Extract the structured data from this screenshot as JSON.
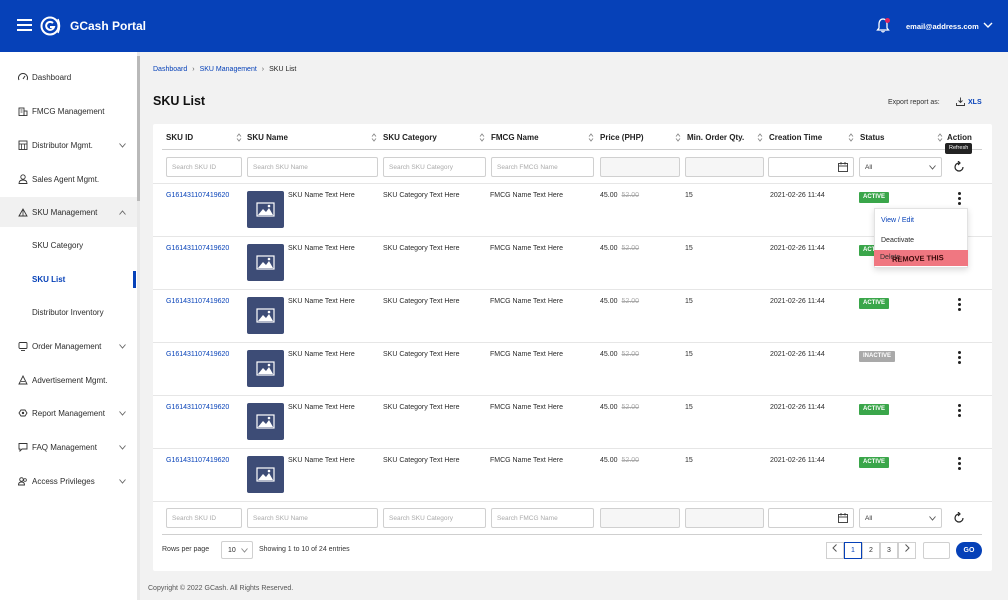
{
  "header": {
    "brand": "GCash Portal",
    "email": "email@address.com",
    "icons": [
      "menu-icon",
      "gcash-logo",
      "bell-icon",
      "chevron-down-icon"
    ]
  },
  "sidebar": {
    "items": [
      {
        "label": "Dashboard",
        "icon": "dashboard-icon"
      },
      {
        "label": "FMCG Management",
        "icon": "building-icon"
      },
      {
        "label": "Distributor Mgmt.",
        "icon": "warehouse-icon"
      },
      {
        "label": "Sales Agent Mgmt.",
        "icon": "user-icon"
      },
      {
        "label": "SKU Management",
        "icon": "box-icon"
      },
      {
        "label": "Order Management",
        "icon": "cart-icon"
      },
      {
        "label": "Advertisement Mgmt.",
        "icon": "megaphone-icon"
      },
      {
        "label": "Report Management",
        "icon": "report-icon"
      },
      {
        "label": "FAQ Management",
        "icon": "faq-icon"
      },
      {
        "label": "Access Privileges",
        "icon": "users-icon"
      }
    ],
    "sub_items": [
      {
        "label": "SKU Category"
      },
      {
        "label": "SKU List"
      },
      {
        "label": "Distributor Inventory"
      }
    ]
  },
  "breadcrumb": {
    "items": [
      "Dashboard",
      "SKU Management",
      "SKU List"
    ]
  },
  "page_title": "SKU List",
  "export": {
    "label": "Export report as:",
    "format": "XLS"
  },
  "table": {
    "columns": [
      "SKU ID",
      "SKU Name",
      "SKU Category",
      "FMCG Name",
      "Price (PHP)",
      "Min. Order Qty.",
      "Creation Time",
      "Status",
      "Action"
    ],
    "filters": {
      "sku_id": "Search SKU ID",
      "sku_name": "Search SKU Name",
      "sku_category": "Search SKU Category",
      "fmcg_name": "Search FMCG Name",
      "status": "All"
    },
    "tooltip": "Refresh",
    "rows": [
      {
        "id": "G161431107419620",
        "name": "SKU Name Text Here",
        "category": "SKU Category Text Here",
        "fmcg": "FMCG Name Text Here",
        "price": "45.00",
        "old_price": "52.00",
        "min_qty": "15",
        "created": "2021-02-26 11:44",
        "status": "ACTIVE"
      },
      {
        "id": "G161431107419620",
        "name": "SKU Name Text Here",
        "category": "SKU Category Text Here",
        "fmcg": "FMCG Name Text Here",
        "price": "45.00",
        "old_price": "52.00",
        "min_qty": "15",
        "created": "2021-02-26 11:44",
        "status": "ACTIVE"
      },
      {
        "id": "G161431107419620",
        "name": "SKU Name Text Here",
        "category": "SKU Category Text Here",
        "fmcg": "FMCG Name Text Here",
        "price": "45.00",
        "old_price": "52.00",
        "min_qty": "15",
        "created": "2021-02-26 11:44",
        "status": "ACTIVE"
      },
      {
        "id": "G161431107419620",
        "name": "SKU Name Text Here",
        "category": "SKU Category Text Here",
        "fmcg": "FMCG Name Text Here",
        "price": "45.00",
        "old_price": "52.00",
        "min_qty": "15",
        "created": "2021-02-26 11:44",
        "status": "INACTIVE"
      },
      {
        "id": "G161431107419620",
        "name": "SKU Name Text Here",
        "category": "SKU Category Text Here",
        "fmcg": "FMCG Name Text Here",
        "price": "45.00",
        "old_price": "52.00",
        "min_qty": "15",
        "created": "2021-02-26 11:44",
        "status": "ACTIVE"
      },
      {
        "id": "G161431107419620",
        "name": "SKU Name Text Here",
        "category": "SKU Category Text Here",
        "fmcg": "FMCG Name Text Here",
        "price": "45.00",
        "old_price": "52.00",
        "min_qty": "15",
        "created": "2021-02-26 11:44",
        "status": "ACTIVE"
      }
    ],
    "action_menu": {
      "items": [
        "View / Edit",
        "Deactivate",
        "Delete"
      ],
      "annotation": "REMOVE THIS"
    }
  },
  "pagination": {
    "rows_label": "Rows per page",
    "rows_value": "10",
    "showing": "Showing 1 to 10 of 24 entries",
    "pages": [
      "1",
      "2",
      "3"
    ],
    "current_page": "1",
    "go_label": "GO"
  },
  "footer": "Copyright © 2022 GCash. All Rights Reserved.",
  "colors": {
    "primary": "#0641b8",
    "active": "#3aa64a",
    "inactive": "#a9a9a9",
    "annotation": "#f07781"
  }
}
